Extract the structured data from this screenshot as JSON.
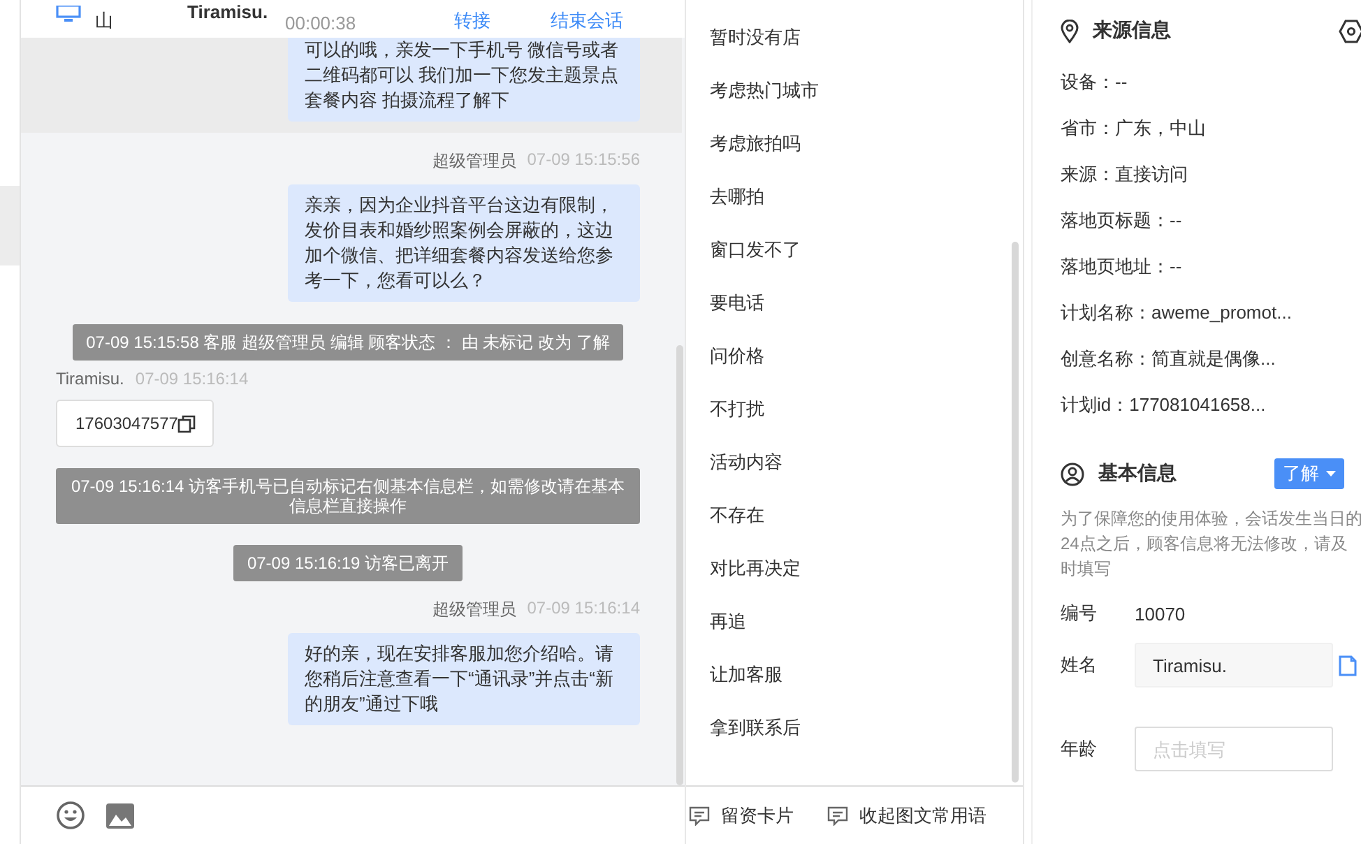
{
  "header": {
    "location": "山",
    "visitor": "Tiramisu.",
    "duration": "00:00:38",
    "actions": [
      "转接",
      "结束会话"
    ]
  },
  "messages": [
    {
      "kind": "agent",
      "highlighted": true,
      "text": "可以的哦，亲发一下手机号 微信号或者二维码都可以 我们加一下您发主题景点套餐内容 拍摄流程了解下"
    },
    {
      "kind": "agent",
      "highlighted": false,
      "name": "超级管理员",
      "time": "07-09 15:15:56",
      "text": "亲亲，因为企业抖音平台这边有限制，发价目表和婚纱照案例会屏蔽的，这边加个微信、把详细套餐内容发送给您参考一下，您看可以么？"
    },
    {
      "kind": "system",
      "text": "07-09 15:15:58 客服 超级管理员 编辑 顾客状态 ： 由 未标记 改为 了解"
    },
    {
      "kind": "visitor",
      "name": "Tiramisu.",
      "time": "07-09 15:16:14",
      "phone": "17603047577"
    },
    {
      "kind": "system",
      "text": "07-09 15:16:14 访客手机号已自动标记右侧基本信息栏，如需修改请在基本信息栏直接操作"
    },
    {
      "kind": "system",
      "text": "07-09 15:16:19 访客已离开"
    },
    {
      "kind": "agent",
      "highlighted": false,
      "name": "超级管理员",
      "time": "07-09 15:16:14",
      "text": "好的亲，现在安排客服加您介绍哈。请您稍后注意查看一下“通讯录”并点击“新的朋友”通过下哦"
    }
  ],
  "quick_replies": [
    "暂时没有店",
    "考虑热门城市",
    "考虑旅拍吗",
    "去哪拍",
    "窗口发不了",
    "要电话",
    "问价格",
    "不打扰",
    "活动内容",
    "不存在",
    "对比再决定",
    "再追",
    "让加客服",
    "拿到联系后"
  ],
  "quick_footer": [
    "留资卡片",
    "收起图文常用语"
  ],
  "source_info": {
    "title": "来源信息",
    "rows": [
      "设备：--",
      "省市：广东，中山",
      "来源：直接访问",
      "落地页标题：--",
      "落地页地址：--",
      "计划名称：aweme_promot...",
      "创意名称：简直就是偶像...",
      "计划id：177081041658..."
    ]
  },
  "basic_info": {
    "title": "基本信息",
    "status": "了解",
    "notice": "为了保障您的使用体验，会话发生当日的24点之后，顾客信息将无法修改，请及时填写",
    "fields": [
      {
        "kind": "text",
        "label": "编号",
        "value": "10070"
      },
      {
        "kind": "input",
        "label": "姓名",
        "value": "Tiramisu.",
        "copyable": true
      },
      {
        "kind": "input",
        "label": "年龄",
        "placeholder": "点击填写",
        "copyable": false
      }
    ]
  }
}
